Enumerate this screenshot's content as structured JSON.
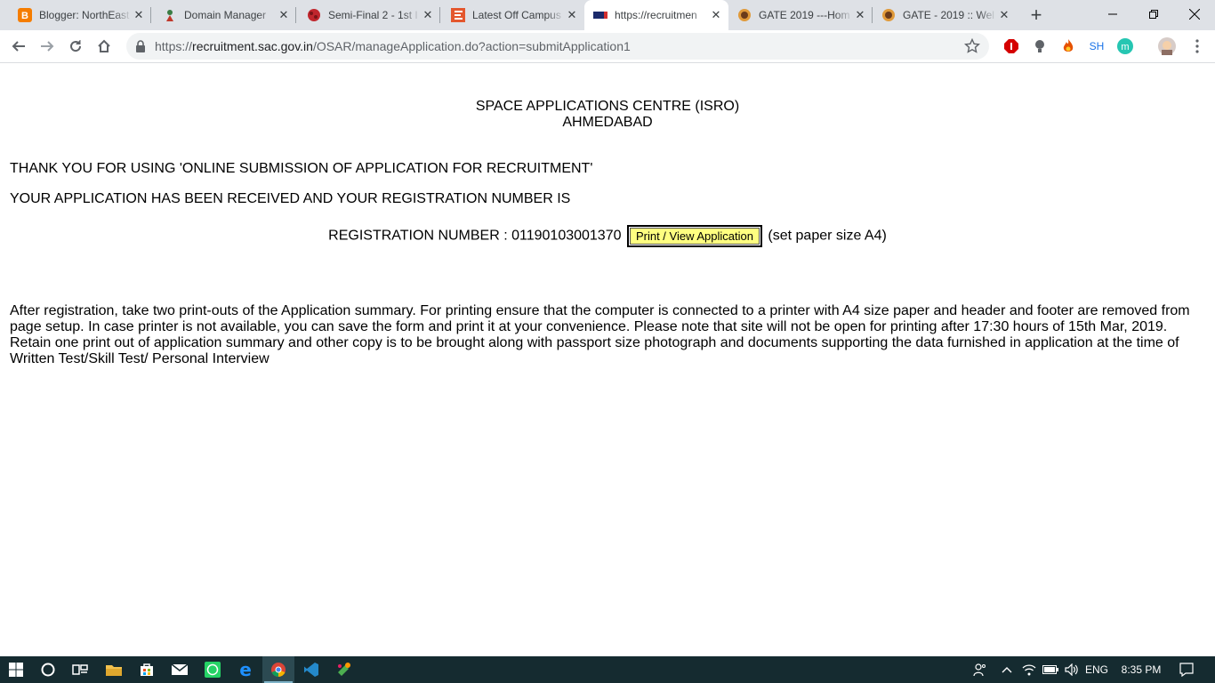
{
  "browser": {
    "tabs": [
      {
        "title": "Blogger: NorthEast",
        "favicon": "blogger-icon",
        "active": false
      },
      {
        "title": "Domain Manager",
        "favicon": "domain-manager-icon",
        "active": false
      },
      {
        "title": "Semi-Final 2 - 1st I",
        "favicon": "cricket-ball-icon",
        "active": false
      },
      {
        "title": "Latest Off Campus",
        "favicon": "e-letter-icon",
        "active": false
      },
      {
        "title": "https://recruitmen",
        "favicon": "sac-logo-icon",
        "active": true
      },
      {
        "title": "GATE 2019 ---Hom",
        "favicon": "gate-logo-icon",
        "active": false
      },
      {
        "title": "GATE - 2019 :: Wel",
        "favicon": "gate-logo-icon",
        "active": false
      }
    ],
    "address_bar": {
      "scheme": "https://",
      "host": "recruitment.sac.gov.in",
      "path": "/OSAR/manageApplication.do?action=submitApplication1"
    },
    "profile_initials": "SH",
    "extension_letter": "m"
  },
  "page": {
    "org_name": "SPACE APPLICATIONS CENTRE (ISRO)",
    "org_city": "AHMEDABAD",
    "thank_you": "THANK YOU FOR USING 'ONLINE SUBMISSION OF APPLICATION FOR RECRUITMENT'",
    "received": "YOUR APPLICATION HAS BEEN RECEIVED AND YOUR REGISTRATION NUMBER IS",
    "reg_label": "REGISTRATION NUMBER : 01190103001370",
    "print_button": "Print / View Application",
    "paper_note": "(set paper size A4)",
    "instructions": "After registration, take two print-outs of the Application summary. For printing ensure that the computer is connected to a printer with A4 size paper and header and footer are removed from page setup. In case printer is not available, you can save the form and print it at your convenience. Please note that site will not be open for printing after 17:30 hours of 15th Mar, 2019. Retain one print out of application summary and other copy is to be brought along with passport size photograph and documents supporting the data furnished in application at the time of Written Test/Skill Test/ Personal Interview"
  },
  "taskbar": {
    "language": "ENG",
    "time": "8:35 PM"
  },
  "colors": {
    "button_bg": "#ffff80",
    "taskbar_bg": "#152b30",
    "tabstrip_bg": "#dee1e6"
  }
}
